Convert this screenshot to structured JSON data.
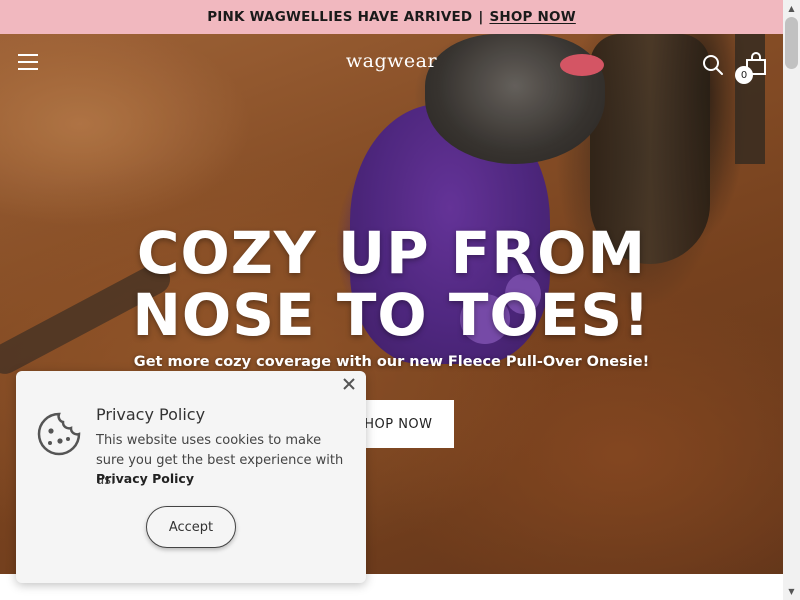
{
  "announcement": {
    "text": "PINK WAGWELLIES HAVE ARRIVED",
    "separator": "|",
    "link_label": "SHOP NOW"
  },
  "header": {
    "logo": "wagwear",
    "cart_count": "0",
    "icons": [
      "menu-icon",
      "search-icon",
      "cart-icon"
    ]
  },
  "hero": {
    "heading_line1": "COZY UP FROM",
    "heading_line2": "NOSE TO TOES!",
    "subheading": "Get more cozy coverage with our new Fleece Pull-Over Onesie!",
    "cta_label": "SHOP NOW"
  },
  "cookie_banner": {
    "title": "Privacy Policy",
    "text": "This website uses cookies to make sure you get the best experience with us.",
    "link_label": "Privacy Policy",
    "accept_label": "Accept",
    "icons": [
      "cookie-icon",
      "close-icon"
    ]
  },
  "colors": {
    "announcement_bg": "#f1b8bf",
    "hero_text": "#ffffff",
    "banner_bg": "#f5f5f5"
  }
}
